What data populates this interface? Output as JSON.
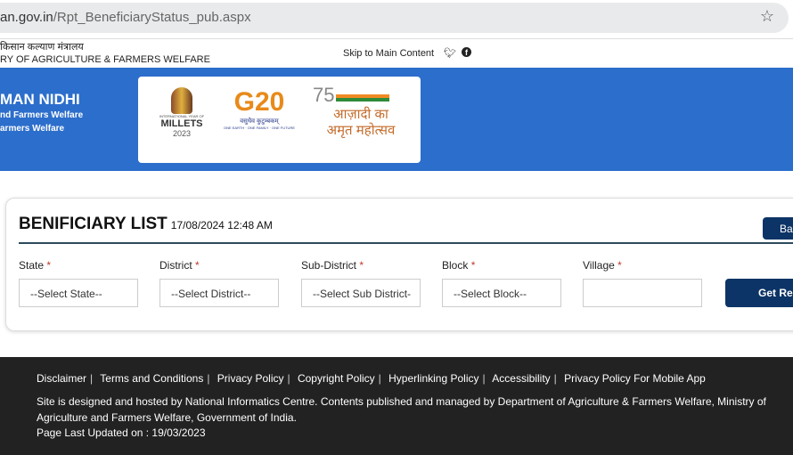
{
  "browser": {
    "url_host": "an.gov.in",
    "url_path": "/Rpt_BeneficiaryStatus_pub.aspx",
    "bookmark_icon": "star-icon"
  },
  "topbar": {
    "hindi": "किसान कल्याण मंत्रालय",
    "ministry": "RY OF AGRICULTURE & FARMERS WELFARE",
    "skip": "Skip to Main Content",
    "social": [
      "twitter-icon",
      "facebook-icon"
    ]
  },
  "banner": {
    "title": "MAN NIDHI",
    "sub1": "nd Farmers Welfare",
    "sub2": "armers Welfare",
    "logos": {
      "millets_top": "INTERNATIONAL YEAR OF",
      "millets": "MILLETS",
      "millets_year": "2023",
      "g20": "G20",
      "g20_sub": "वसुधैव कुटुम्बकम्",
      "g20_tag": "ONE EARTH · ONE FAMILY · ONE FUTURE",
      "azadi1": "आज़ादी का",
      "azadi2": "अमृत महोत्सव",
      "azadi_num": "75"
    },
    "colors": {
      "banner": "#2c6ecb"
    }
  },
  "report": {
    "title": "BENIFICIARY LIST",
    "datetime": "17/08/2024 12:48 AM",
    "back_label": "Back",
    "get_report_label": "Get Report",
    "fields": [
      {
        "label": "State",
        "value": "--Select State--"
      },
      {
        "label": "District",
        "value": "--Select District--"
      },
      {
        "label": "Sub-District",
        "value": "--Select Sub District-"
      },
      {
        "label": "Block",
        "value": "--Select Block--"
      },
      {
        "label": "Village",
        "value": ""
      }
    ],
    "required_mark": "*"
  },
  "footer": {
    "links": [
      "Disclaimer",
      "Terms and Conditions",
      "Privacy Policy",
      "Copyright Policy",
      "Hyperlinking Policy",
      "Accessibility",
      "Privacy Policy For Mobile App"
    ],
    "text": "Site is designed and hosted by National Informatics Centre. Contents published and managed by Department of Agriculture & Farmers Welfare, Ministry of Agriculture and Farmers Welfare, Government of India.",
    "updated": "Page Last Updated on : 19/03/2023"
  }
}
